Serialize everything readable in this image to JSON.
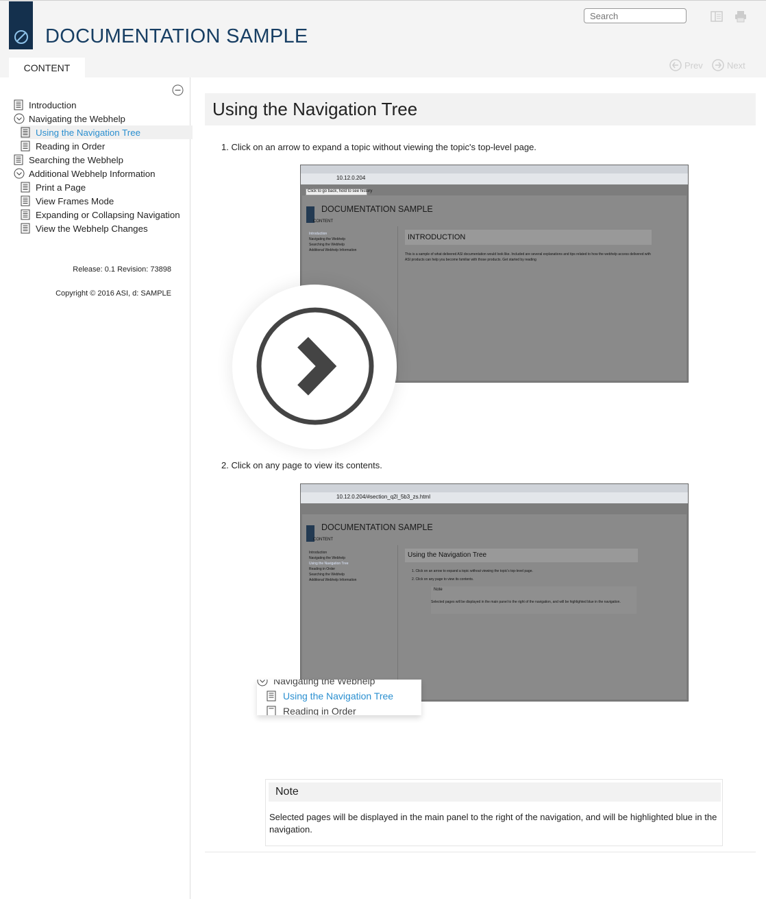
{
  "header": {
    "title": "DOCUMENTATION SAMPLE",
    "search_placeholder": "Search",
    "tab_content": "CONTENT",
    "prev_label": "Prev",
    "next_label": "Next"
  },
  "sidebar": {
    "items": [
      {
        "label": "Introduction",
        "icon": "page-icon",
        "level": 0
      },
      {
        "label": "Navigating the Webhelp",
        "icon": "expanded-arrow-icon",
        "level": 0
      },
      {
        "label": "Using the Navigation Tree",
        "icon": "page-icon",
        "level": 1,
        "active": true
      },
      {
        "label": "Reading in Order",
        "icon": "page-icon",
        "level": 1
      },
      {
        "label": "Searching the Webhelp",
        "icon": "page-icon",
        "level": 0
      },
      {
        "label": "Additional Webhelp Information",
        "icon": "expanded-arrow-icon",
        "level": 0
      },
      {
        "label": "Print a Page",
        "icon": "page-icon",
        "level": 1
      },
      {
        "label": "View Frames Mode",
        "icon": "page-icon",
        "level": 1
      },
      {
        "label": "Expanding or Collapsing Navigation",
        "icon": "page-icon",
        "level": 1
      },
      {
        "label": "View the Webhelp Changes",
        "icon": "page-icon",
        "level": 1
      }
    ],
    "release": "Release: 0.1  Revision: 73898",
    "copyright": "Copyright © 2016 ASI, d: SAMPLE"
  },
  "main": {
    "title": "Using the Navigation Tree",
    "step1": "1. Click on an arrow to expand a topic without viewing the topic's top-level page.",
    "step2": "2. Click on any page to view its contents.",
    "shot1": {
      "address": "10.12.0.204",
      "tooltip": "Click to go back, hold to see history",
      "app_title": "DOCUMENTATION SAMPLE",
      "tab": "CONTENT",
      "toc": [
        "Introduction",
        "Navigating the Webhelp",
        "Searching the Webhelp",
        "Additional Webhelp Information"
      ],
      "heading": "INTRODUCTION",
      "body": "This is a sample of what delivered ASI documentation would look like. Included are several explanations and tips related to how the webhelp access delivered with ASI products can help you become familiar with those products. Get started by reading"
    },
    "shot2": {
      "address": "10.12.0.204/#section_q2l_5b3_zs.html",
      "app_title": "DOCUMENTATION SAMPLE",
      "tab": "CONTENT",
      "toc": [
        "Introduction",
        "Navigating the Webhelp",
        "Using the Navigation Tree",
        "Reading in Order",
        "Searching the Webhelp",
        "Additional Webhelp Information"
      ],
      "heading": "Using the Navigation Tree",
      "step1": "1. Click on an arrow to expand a topic without viewing the topic's top-level page.",
      "step2": "2. Click on any page to view its contents.",
      "note_title": "Note",
      "note_body": "Selected pages will be displayed in the main panel to the right of the navigation, and will be highlighted blue in the navigation."
    },
    "callout": {
      "item1": "Navigating the Webhelp",
      "item2": "Using the Navigation Tree",
      "item3": "Reading in Order"
    },
    "note": {
      "title": "Note",
      "body": "Selected pages will be displayed in the main panel to the right of the navigation, and will be highlighted blue in the navigation."
    }
  },
  "colors": {
    "brand": "#173e63",
    "link_active": "#2a8fd0",
    "logo_bg": "#14304d"
  }
}
